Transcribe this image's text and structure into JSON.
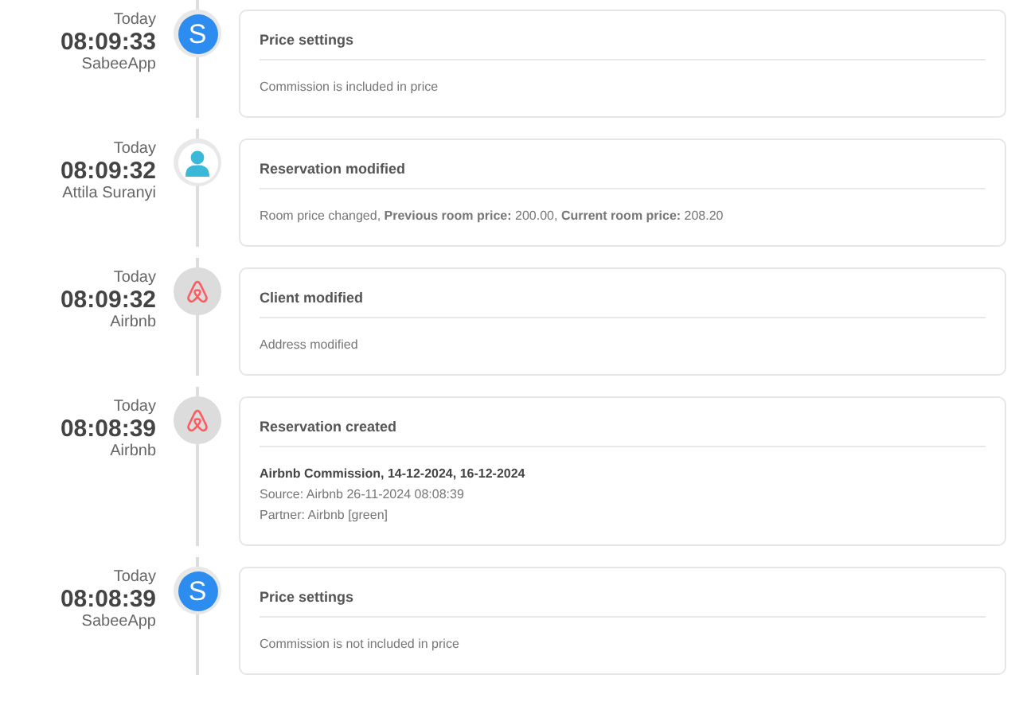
{
  "events": [
    {
      "day": "Today",
      "time": "08:09:33",
      "author": "SabeeApp",
      "avatar": {
        "kind": "letter",
        "letter": "S"
      },
      "title": "Price settings",
      "lines": [
        {
          "kind": "plain",
          "text": "Commission is included in price"
        }
      ]
    },
    {
      "day": "Today",
      "time": "08:09:32",
      "author": "Attila Suranyi",
      "avatar": {
        "kind": "person"
      },
      "title": "Reservation modified",
      "lines": [
        {
          "kind": "plain",
          "text": "Room price changed, **Previous room price:** 200.00, **Current room price:** 208.20"
        }
      ]
    },
    {
      "day": "Today",
      "time": "08:09:32",
      "author": "Airbnb",
      "avatar": {
        "kind": "airbnb"
      },
      "title": "Client modified",
      "lines": [
        {
          "kind": "plain",
          "text": "Address modified"
        }
      ]
    },
    {
      "day": "Today",
      "time": "08:08:39",
      "author": "Airbnb",
      "avatar": {
        "kind": "airbnb"
      },
      "title": "Reservation created",
      "lines": [
        {
          "kind": "heading",
          "text": "Airbnb Commission, 14-12-2024, 16-12-2024"
        },
        {
          "kind": "plain",
          "text": "Source: Airbnb 26-11-2024 08:08:39"
        },
        {
          "kind": "plain",
          "text": "Partner: Airbnb [green]"
        }
      ]
    },
    {
      "day": "Today",
      "time": "08:08:39",
      "author": "SabeeApp",
      "avatar": {
        "kind": "letter",
        "letter": "S"
      },
      "title": "Price settings",
      "lines": [
        {
          "kind": "plain",
          "text": "Commission is not included in price"
        }
      ]
    }
  ]
}
